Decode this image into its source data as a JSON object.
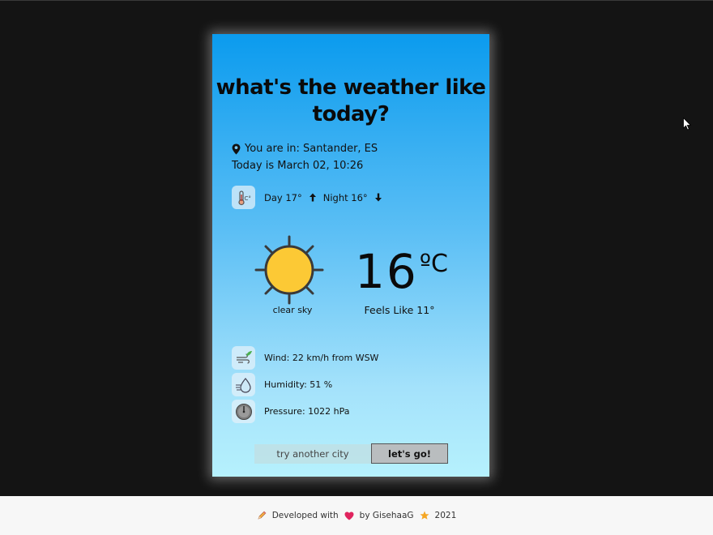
{
  "app": {
    "title": "what's the weather like today?"
  },
  "location": {
    "text": "You are in: Santander, ES",
    "icon": "map-pin-icon"
  },
  "date": {
    "text": "Today is March 02, 10:26"
  },
  "daynight": {
    "icon": "thermometer-celsius-icon",
    "day": "Day 17°",
    "night": "Night 16°"
  },
  "current": {
    "condition": "clear sky",
    "icon": "sun-icon",
    "temp": "16",
    "unit": "ºC",
    "feels_like": "Feels Like 11°"
  },
  "details": [
    {
      "icon": "wind-icon",
      "text": "Wind: 22 km/h from WSW"
    },
    {
      "icon": "humidity-icon",
      "text": "Humidity: 51 %"
    },
    {
      "icon": "barometer-icon",
      "text": "Pressure: 1022 hPa"
    }
  ],
  "search": {
    "placeholder": "try another city",
    "button_label": "let's go!"
  },
  "footer": {
    "developed": "Developed with",
    "by": "by GisehaaG",
    "year": "2021"
  },
  "colors": {
    "card_top": "#0b9bee",
    "card_bottom": "#b6f1fd",
    "sun": "#fbc531",
    "heart": "#e0245e",
    "star": "#f5a623"
  }
}
